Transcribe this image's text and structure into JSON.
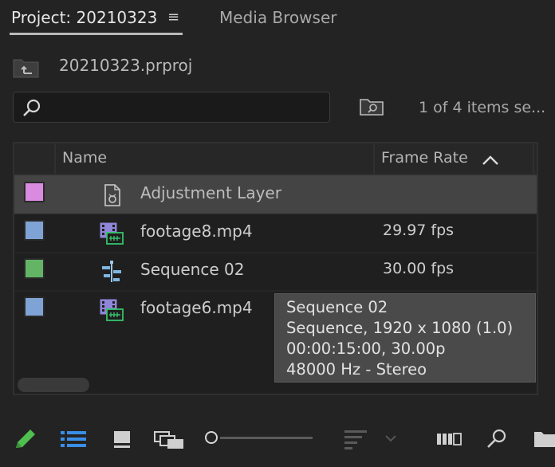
{
  "tabs": {
    "project_label": "Project: 20210323",
    "menu_glyph": "≡",
    "media_label": "Media Browser"
  },
  "path": {
    "filename": "20210323.prproj",
    "up_icon": "folder-up-icon"
  },
  "search": {
    "value": "",
    "placeholder": "",
    "icon": "search-icon"
  },
  "items_count": "1 of 4 items se...",
  "table": {
    "headers": {
      "name": "Name",
      "frame_rate": "Frame Rate",
      "sort_icon": "chevron-up-icon"
    },
    "rows": [
      {
        "label_color": "#d98be0",
        "icon": "adjustment-layer-icon",
        "name": "Adjustment Layer",
        "frame_rate": "",
        "selected": true
      },
      {
        "label_color": "#7fa3d4",
        "icon": "video-clip-icon",
        "name": "footage8.mp4",
        "frame_rate": "29.97 fps",
        "selected": false
      },
      {
        "label_color": "#63b565",
        "icon": "sequence-icon",
        "name": "Sequence 02",
        "frame_rate": "30.00 fps",
        "selected": false
      },
      {
        "label_color": "#7fa3d4",
        "icon": "video-clip-icon",
        "name": "footage6.mp4",
        "frame_rate": "",
        "selected": false
      }
    ]
  },
  "tooltip": {
    "line1": "Sequence 02",
    "line2": "Sequence, 1920 x 1080 (1.0)",
    "line3": "00:00:15:00, 30.00p",
    "line4": "48000 Hz - Stereo"
  },
  "toolbar": {
    "icons": [
      "pencil-icon",
      "list-view-icon",
      "icon-view-icon",
      "freeform-view-icon",
      "zoom-slider",
      "sort-icon",
      "chevron-down-icon",
      "automate-to-sequence-icon",
      "find-icon",
      "new-bin-icon"
    ],
    "accent": "#3a8ee6",
    "pencil_color": "#4fbf4f"
  }
}
